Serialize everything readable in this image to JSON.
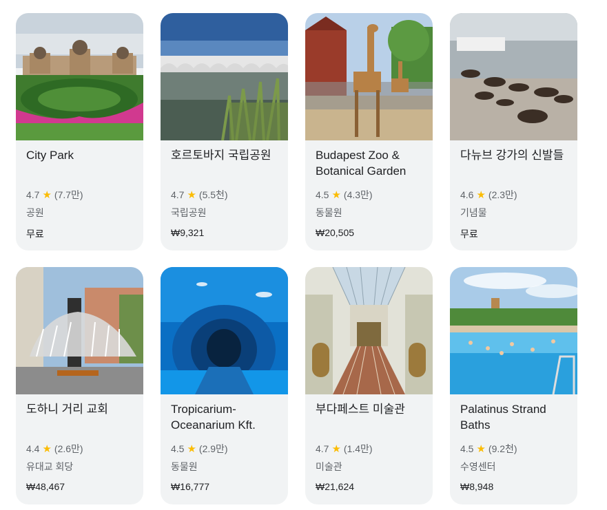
{
  "cards": [
    {
      "name": "City Park",
      "rating": "4.7",
      "reviews": "(7.7만)",
      "category": "공원",
      "price": "무료",
      "image_icon": "castle-garden-photo"
    },
    {
      "name": "호르토바지 국립공원",
      "rating": "4.7",
      "reviews": "(5.5천)",
      "category": "국립공원",
      "price": "₩9,321",
      "image_icon": "bridge-lake-photo"
    },
    {
      "name": "Budapest Zoo & Botanical Garden",
      "rating": "4.5",
      "reviews": "(4.3만)",
      "category": "동물원",
      "price": "₩20,505",
      "image_icon": "giraffe-photo"
    },
    {
      "name": "다뉴브 강가의 신발들",
      "rating": "4.6",
      "reviews": "(2.3만)",
      "category": "기념물",
      "price": "무료",
      "image_icon": "shoes-riverbank-photo"
    },
    {
      "name": "도하니 거리 교회",
      "rating": "4.4",
      "reviews": "(2.6만)",
      "category": "유대교 회당",
      "price": "₩48,467",
      "image_icon": "memorial-tree-photo"
    },
    {
      "name": "Tropicarium-Oceanarium Kft.",
      "rating": "4.5",
      "reviews": "(2.9만)",
      "category": "동물원",
      "price": "₩16,777",
      "image_icon": "aquarium-tunnel-photo"
    },
    {
      "name": "부다페스트 미술관",
      "rating": "4.7",
      "reviews": "(1.4만)",
      "category": "미술관",
      "price": "₩21,624",
      "image_icon": "museum-hall-photo"
    },
    {
      "name": "Palatinus Strand Baths",
      "rating": "4.5",
      "reviews": "(9.2천)",
      "category": "수영센터",
      "price": "₩8,948",
      "image_icon": "pool-photo"
    }
  ],
  "star_glyph": "★",
  "colors": {
    "card_bg": "#f1f3f4",
    "star": "#fbbc04",
    "title": "#202124",
    "muted": "#5f6368"
  }
}
